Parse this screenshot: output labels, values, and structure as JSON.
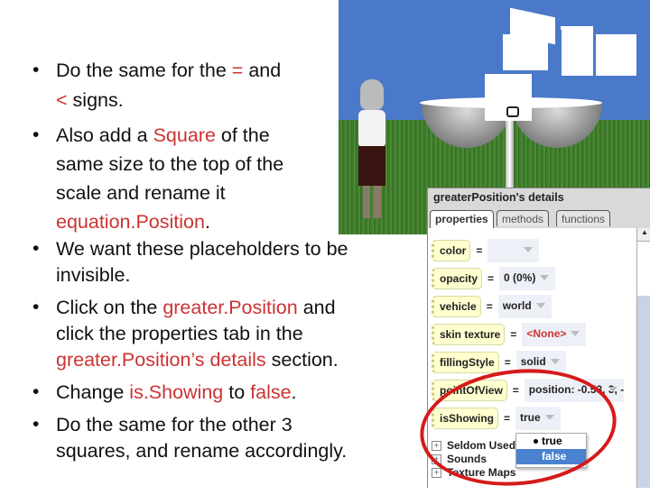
{
  "slide": {
    "bullets": [
      {
        "lines": [
          [
            {
              "t": "Do the same for the "
            },
            {
              "t": "=",
              "red": true
            },
            {
              "t": " and"
            }
          ],
          [
            {
              "t": "<",
              "red": true
            },
            {
              "t": " signs."
            }
          ]
        ]
      },
      {
        "lines": [
          [
            {
              "t": "Also add a "
            },
            {
              "t": "Square",
              "red": true
            },
            {
              "t": " of the"
            }
          ],
          [
            {
              "t": "same size to the top of the"
            }
          ],
          [
            {
              "t": "scale and rename it"
            }
          ],
          [
            {
              "t": "equation.Position",
              "red": true
            },
            {
              "t": "."
            }
          ]
        ]
      },
      {
        "lines": [
          [
            {
              "t": "We want these placeholders to be"
            }
          ],
          [
            {
              "t": "invisible."
            }
          ]
        ]
      },
      {
        "lines": [
          [
            {
              "t": "Click on the "
            },
            {
              "t": "greater.Position",
              "red": true
            },
            {
              "t": " and"
            }
          ],
          [
            {
              "t": "click the properties tab in the"
            }
          ],
          [
            {
              "t": "greater.Position’s details",
              "red": true
            },
            {
              "t": " section."
            }
          ]
        ]
      },
      {
        "lines": [
          [
            {
              "t": "Change "
            },
            {
              "t": "is.Showing",
              "red": true
            },
            {
              "t": " to "
            },
            {
              "t": "false",
              "red": true
            },
            {
              "t": "."
            }
          ]
        ]
      },
      {
        "lines": [
          [
            {
              "t": "Do the same for the other 3"
            }
          ],
          [
            {
              "t": "squares, and rename accordingly."
            }
          ]
        ]
      }
    ],
    "accent_color": "#cc3333"
  },
  "details_panel": {
    "title": "greaterPosition's details",
    "tabs": [
      {
        "label": "properties",
        "active": true
      },
      {
        "label": "methods"
      },
      {
        "label": "functions"
      }
    ],
    "properties": [
      {
        "name": "color",
        "value": ""
      },
      {
        "name": "opacity",
        "value": "0 (0%)"
      },
      {
        "name": "vehicle",
        "value": "world"
      },
      {
        "name": "skin texture",
        "value": "<None>",
        "red": true
      },
      {
        "name": "fillingStyle",
        "value": "solid"
      },
      {
        "name": "pointOfView",
        "value": "position: -0.53, 3, -"
      },
      {
        "name": "isShowing",
        "value": "true"
      }
    ],
    "groups": [
      "Seldom Used",
      "Sounds",
      "Texture Maps"
    ],
    "dropdown_options": [
      {
        "label": "true",
        "checked": true
      },
      {
        "label": "false",
        "highlighted": true
      }
    ]
  }
}
